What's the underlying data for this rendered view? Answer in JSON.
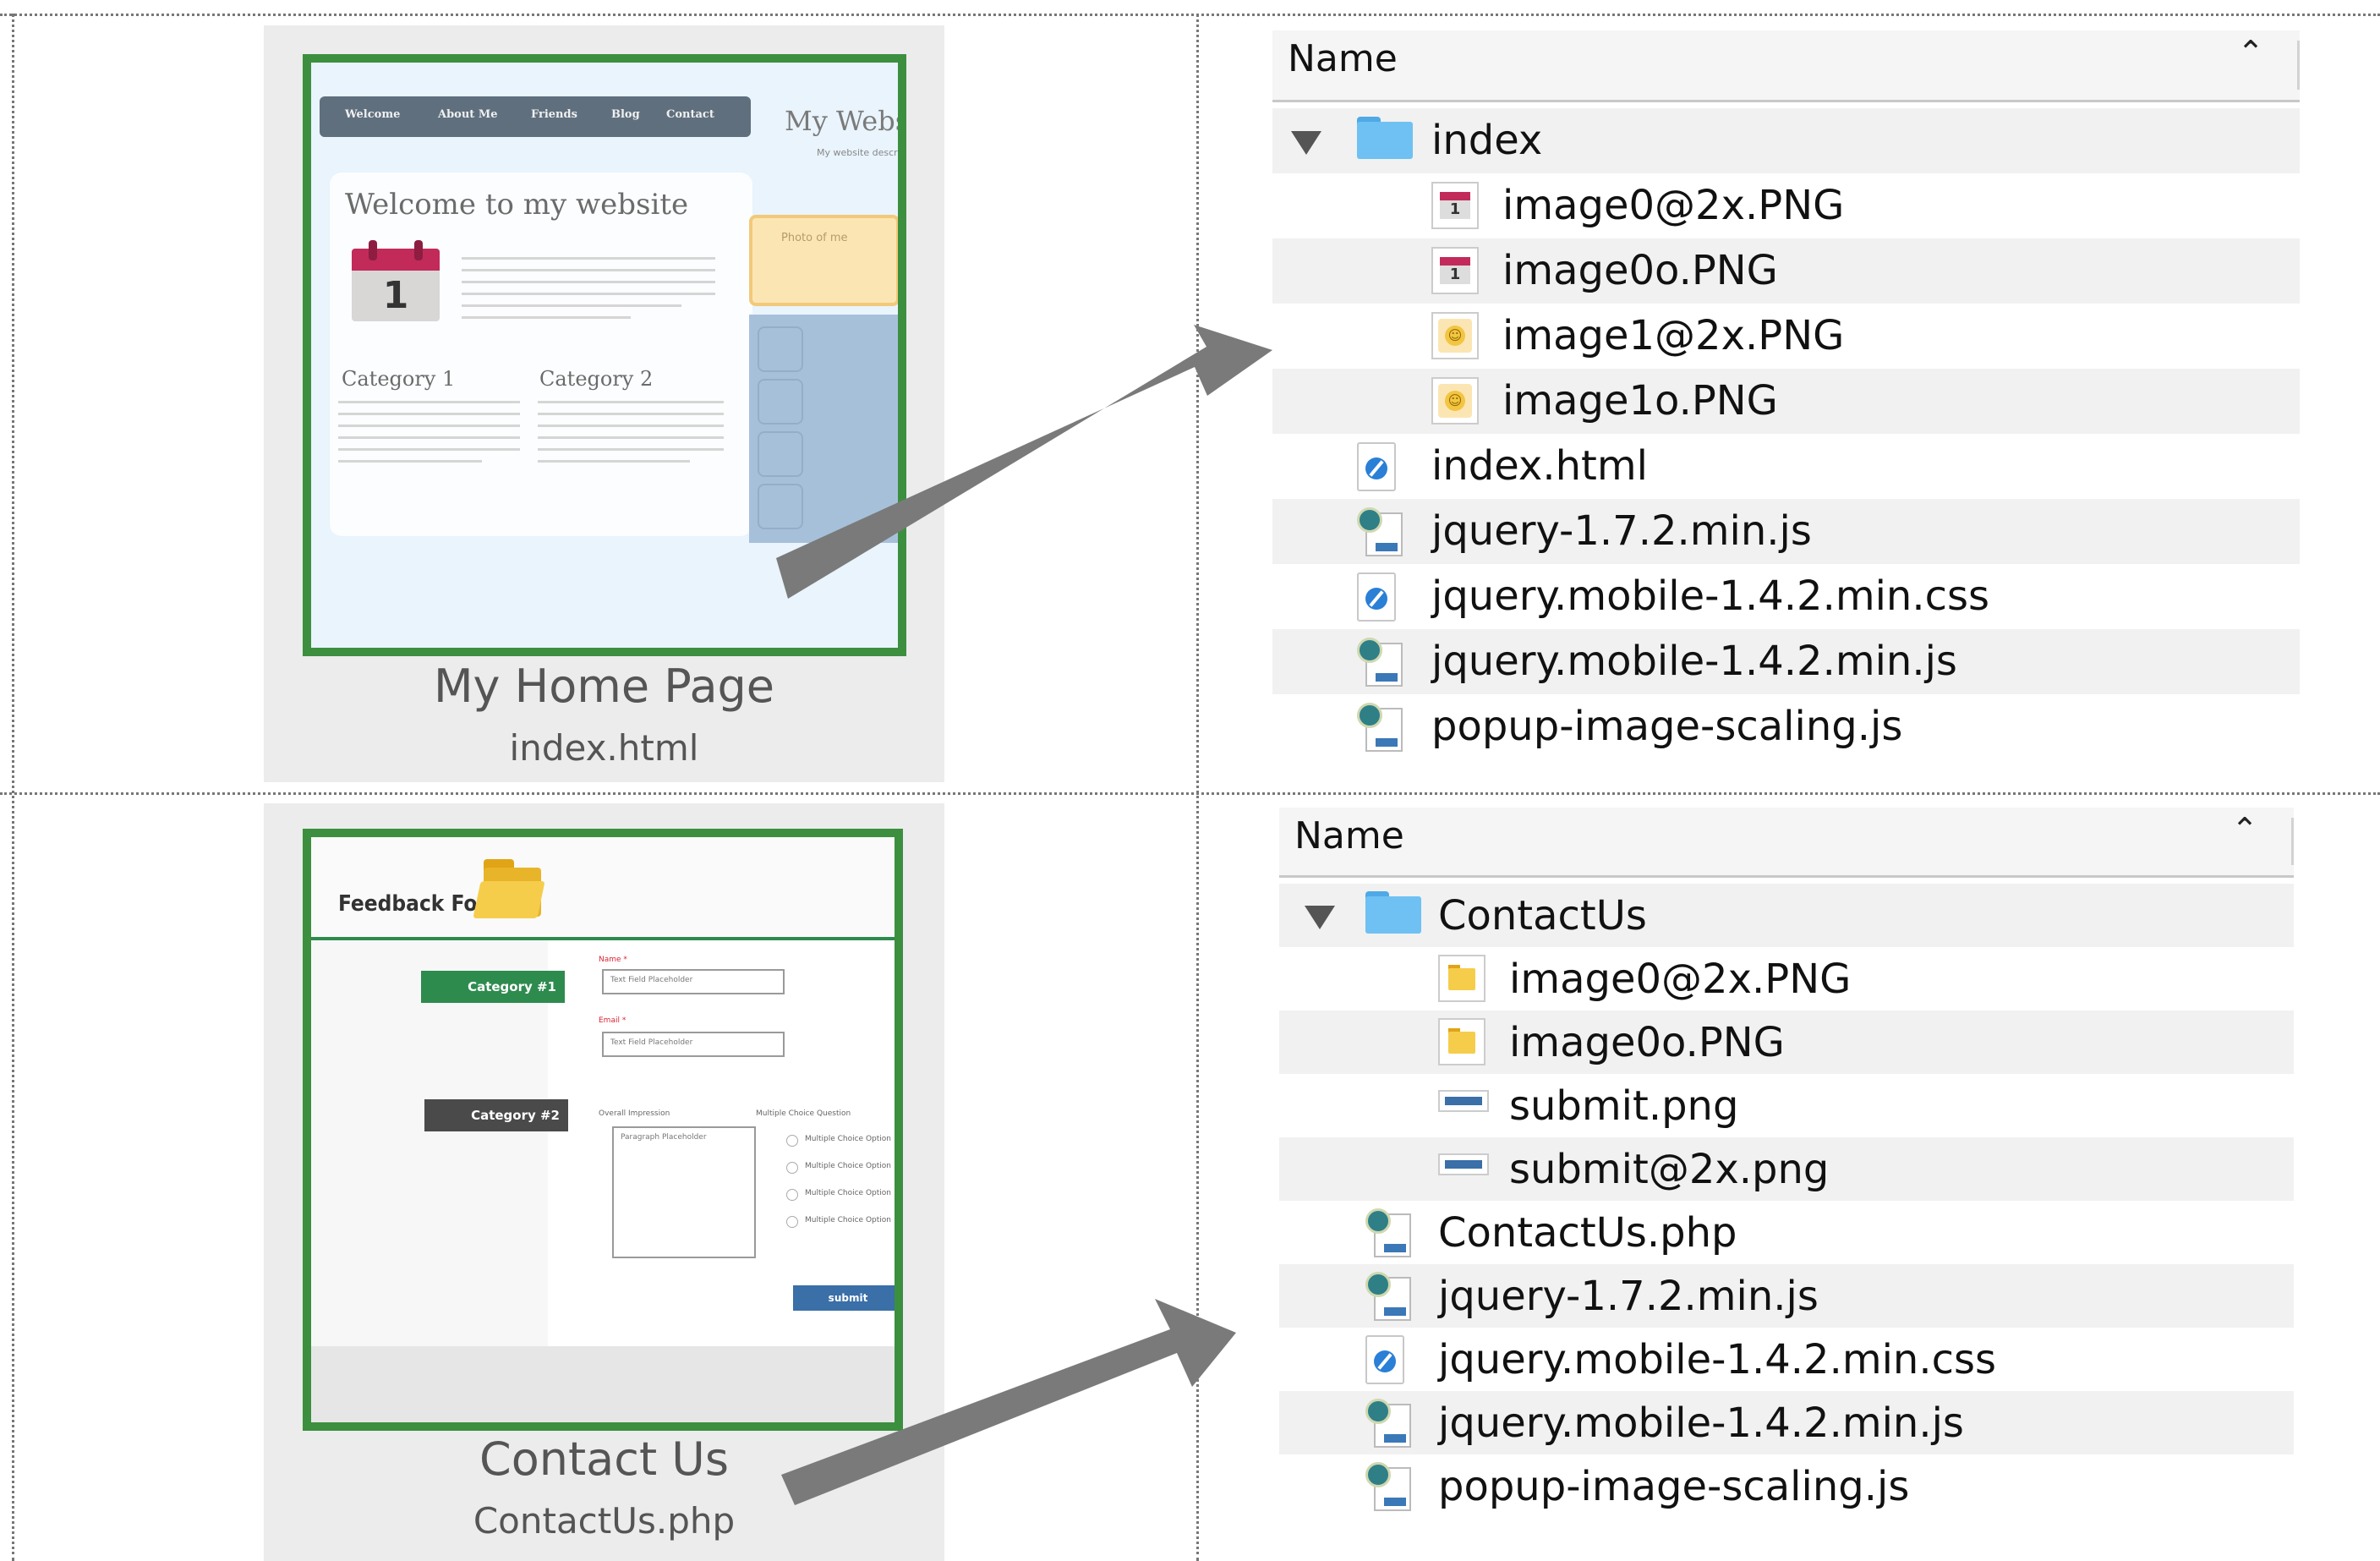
{
  "top": {
    "thumbnail": {
      "title": "My Home Page",
      "filename": "index.html",
      "preview": {
        "nav": [
          "Welcome",
          "About Me",
          "Friends",
          "Blog",
          "Contact"
        ],
        "site_title": "My Website",
        "site_subtitle": "My website description",
        "welcome": "Welcome to my website",
        "calendar_day": "1",
        "photo_label": "Photo of me",
        "category1": "Category 1",
        "category2": "Category 2"
      }
    },
    "finder": {
      "header": "Name",
      "rows": [
        {
          "label": "index",
          "icon": "folder-icon",
          "indent": 0,
          "disclosure": true
        },
        {
          "label": "image0@2x.PNG",
          "icon": "calendar-image-icon",
          "indent": 1
        },
        {
          "label": "image0o.PNG",
          "icon": "calendar-image-icon",
          "indent": 1
        },
        {
          "label": "image1@2x.PNG",
          "icon": "smiley-image-icon",
          "indent": 1
        },
        {
          "label": "image1o.PNG",
          "icon": "smiley-image-icon",
          "indent": 1
        },
        {
          "label": "index.html",
          "icon": "safari-document-icon",
          "indent": 0
        },
        {
          "label": "jquery-1.7.2.min.js",
          "icon": "script-document-icon",
          "indent": 0
        },
        {
          "label": "jquery.mobile-1.4.2.min.css",
          "icon": "safari-document-icon",
          "indent": 0
        },
        {
          "label": "jquery.mobile-1.4.2.min.js",
          "icon": "script-document-icon",
          "indent": 0
        },
        {
          "label": "popup-image-scaling.js",
          "icon": "script-document-icon",
          "indent": 0
        }
      ]
    }
  },
  "bottom": {
    "thumbnail": {
      "title": "Contact Us",
      "filename": "ContactUs.php",
      "preview": {
        "form_title": "Feedback Form",
        "category1": "Category #1",
        "category2": "Category #2",
        "name_label": "Name *",
        "email_label": "Email *",
        "field_placeholder": "Text Field Placeholder",
        "overall_label": "Overall Impression",
        "mc_label": "Multiple Choice Question",
        "paragraph_placeholder": "Paragraph Placeholder",
        "mc_option": "Multiple Choice Option",
        "submit": "submit"
      }
    },
    "finder": {
      "header": "Name",
      "rows": [
        {
          "label": "ContactUs",
          "icon": "folder-icon",
          "indent": 0,
          "disclosure": true
        },
        {
          "label": "image0@2x.PNG",
          "icon": "folder-image-icon",
          "indent": 1
        },
        {
          "label": "image0o.PNG",
          "icon": "folder-image-icon",
          "indent": 1
        },
        {
          "label": "submit.png",
          "icon": "button-image-icon",
          "indent": 1
        },
        {
          "label": "submit@2x.png",
          "icon": "button-image-icon",
          "indent": 1
        },
        {
          "label": "ContactUs.php",
          "icon": "script-document-icon",
          "indent": 0
        },
        {
          "label": "jquery-1.7.2.min.js",
          "icon": "script-document-icon",
          "indent": 0
        },
        {
          "label": "jquery.mobile-1.4.2.min.css",
          "icon": "safari-document-icon",
          "indent": 0
        },
        {
          "label": "jquery.mobile-1.4.2.min.js",
          "icon": "script-document-icon",
          "indent": 0
        },
        {
          "label": "popup-image-scaling.js",
          "icon": "script-document-icon",
          "indent": 0
        }
      ]
    }
  },
  "colors": {
    "thumb_border": "#3c8f3f",
    "arrow": "#7a7a7a",
    "folder": "#6ec1f2",
    "form_green": "#2e8b4e",
    "form_dark": "#4a4a4a"
  }
}
